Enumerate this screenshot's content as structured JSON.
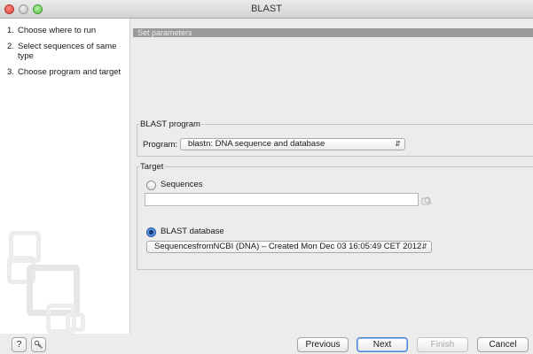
{
  "window": {
    "title": "BLAST"
  },
  "steps": [
    {
      "num": "1.",
      "label": "Choose where to run"
    },
    {
      "num": "2.",
      "label": "Select sequences of same type"
    },
    {
      "num": "3.",
      "label": "Choose program and target"
    }
  ],
  "section": {
    "title": "Set parameters"
  },
  "blast_program": {
    "legend": "BLAST program",
    "label": "Program:",
    "value": "blastn: DNA sequence and database"
  },
  "target": {
    "legend": "Target",
    "sequences_label": "Sequences",
    "sequences_selected": false,
    "sequences_value": "",
    "database_label": "BLAST database",
    "database_selected": true,
    "database_value": "SequencesfromNCBI (DNA) – Created Mon Dec 03 16:05:49 CET 2012"
  },
  "footer": {
    "help_label": "?",
    "previous_label": "Previous",
    "next_label": "Next",
    "finish_label": "Finish",
    "cancel_label": "Cancel"
  },
  "icons": {
    "help": "question-mark",
    "pin": "pin-icon",
    "pick": "browse-icon",
    "select_arrows": "up-down-arrows"
  }
}
